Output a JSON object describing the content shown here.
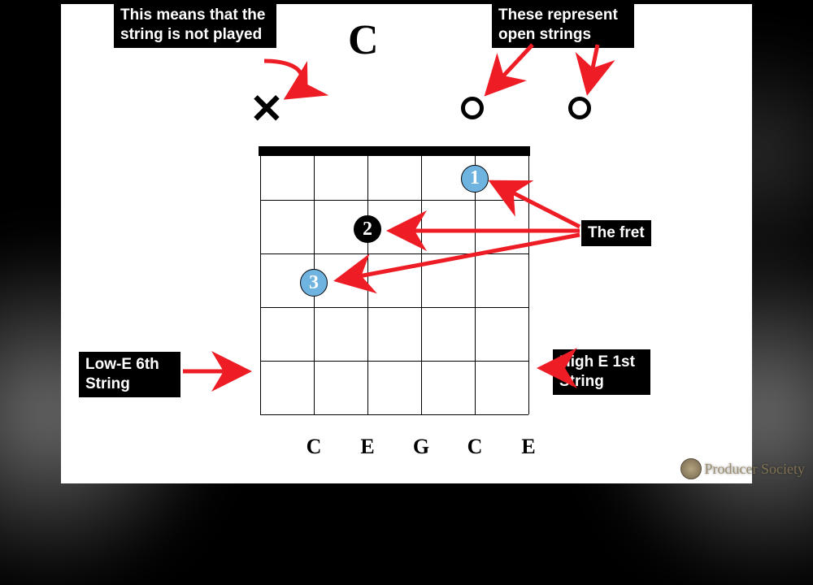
{
  "chord_name": "C",
  "symbols": {
    "mute": "✕",
    "open_label": "O"
  },
  "bottom_notes": [
    "C",
    "E",
    "G",
    "C",
    "E"
  ],
  "fingers": [
    {
      "string": 2,
      "fret": 1,
      "num": "1",
      "color": "blue"
    },
    {
      "string": 4,
      "fret": 2,
      "num": "2",
      "color": "black"
    },
    {
      "string": 5,
      "fret": 3,
      "num": "3",
      "color": "blue"
    }
  ],
  "callouts": {
    "mute": "This means that the string is not played",
    "open": "These represent open strings",
    "fret": "The fret",
    "low_e": "Low-E 6th String",
    "high_e": "High E 1st String"
  },
  "logo_text": "Producer Society"
}
